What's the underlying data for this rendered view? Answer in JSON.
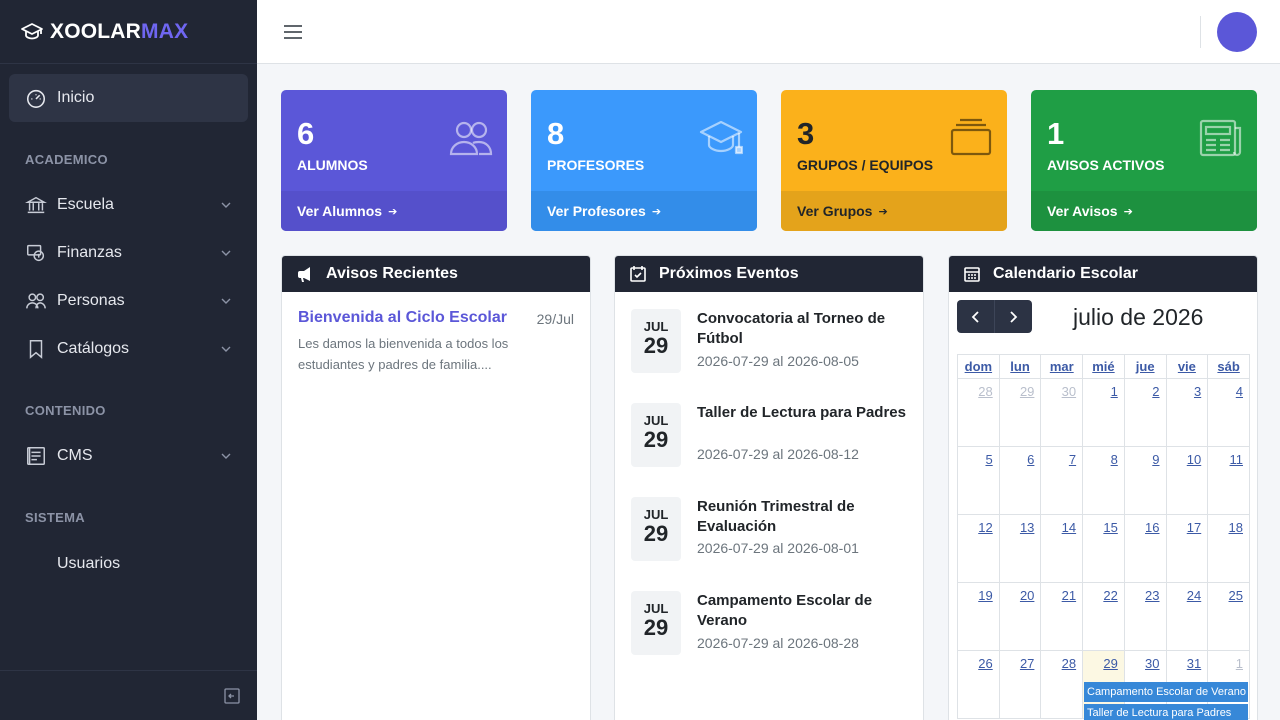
{
  "brand": {
    "part1": "XOOLAR",
    "part2": "MAX"
  },
  "sidebar": {
    "active": {
      "label": "Inicio",
      "icon": "dashboard-icon"
    },
    "sections": [
      {
        "title": "ACADEMICO"
      },
      {
        "title": "CONTENIDO"
      },
      {
        "title": "SISTEMA"
      }
    ],
    "items": [
      {
        "label": "Escuela",
        "icon": "school-icon"
      },
      {
        "label": "Finanzas",
        "icon": "finance-icon"
      },
      {
        "label": "Personas",
        "icon": "people-icon"
      },
      {
        "label": "Catálogos",
        "icon": "bookmark-icon"
      },
      {
        "label": "CMS",
        "icon": "cms-icon"
      },
      {
        "label": "Usuarios"
      }
    ]
  },
  "stats": [
    {
      "value": "6",
      "label": "ALUMNOS",
      "link": "Ver Alumnos",
      "color": "#5b57d8",
      "foot_color": "#5550cb",
      "icon": "users-icon"
    },
    {
      "value": "8",
      "label": "PROFESORES",
      "link": "Ver Profesores",
      "color": "#3b99fc",
      "foot_color": "#338de9",
      "icon": "graduation-cap-icon"
    },
    {
      "value": "3",
      "label": "GRUPOS / EQUIPOS",
      "link": "Ver Grupos",
      "color": "#fbb11b",
      "foot_color": "#e4a31b",
      "icon": "layers-icon"
    },
    {
      "value": "1",
      "label": "AVISOS ACTIVOS",
      "link": "Ver Avisos",
      "color": "#1f9e45",
      "foot_color": "#1d913f",
      "icon": "newspaper-icon"
    }
  ],
  "avisos": {
    "title": "Avisos Recientes",
    "item": {
      "title": "Bienvenida al Ciclo Escolar",
      "date": "29/Jul",
      "body": "Les damos la bienvenida a todos los estudiantes y padres de familia...."
    }
  },
  "eventos": {
    "title": "Próximos Eventos",
    "items": [
      {
        "month": "JUL",
        "day": "29",
        "title": "Convocatoria al Torneo de Fútbol",
        "range": "2026-07-29 al 2026-08-05"
      },
      {
        "month": "JUL",
        "day": "29",
        "title": "Taller de Lectura para Padres",
        "range": "2026-07-29 al 2026-08-12"
      },
      {
        "month": "JUL",
        "day": "29",
        "title": "Reunión Trimestral de Evaluación",
        "range": "2026-07-29 al 2026-08-01"
      },
      {
        "month": "JUL",
        "day": "29",
        "title": "Campamento Escolar de Verano",
        "range": "2026-07-29 al 2026-08-28"
      }
    ]
  },
  "calendar": {
    "title": "Calendario Escolar",
    "month_title": "julio de 2026",
    "weekdays": [
      "dom",
      "lun",
      "mar",
      "mié",
      "jue",
      "vie",
      "sáb"
    ],
    "weeks": [
      [
        "28",
        "29",
        "30",
        "1",
        "2",
        "3",
        "4"
      ],
      [
        "5",
        "6",
        "7",
        "8",
        "9",
        "10",
        "11"
      ],
      [
        "12",
        "13",
        "14",
        "15",
        "16",
        "17",
        "18"
      ],
      [
        "19",
        "20",
        "21",
        "22",
        "23",
        "24",
        "25"
      ],
      [
        "26",
        "27",
        "28",
        "29",
        "30",
        "31",
        "1"
      ]
    ],
    "events": [
      {
        "label": "Campamento Escolar de Verano"
      },
      {
        "label": "Taller de Lectura para Padres"
      }
    ]
  }
}
